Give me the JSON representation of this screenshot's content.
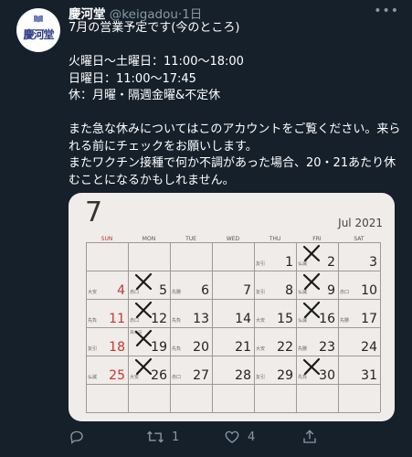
{
  "account": {
    "avatar_text": "慶河堂",
    "name": "慶河堂",
    "handle": "@keigadou",
    "separator": "·",
    "time": "1日",
    "more_icon": "more-dots-icon"
  },
  "tweet": {
    "lines": [
      "7月の営業予定です(今のところ)",
      "",
      "火曜日～土曜日：11:00～18:00",
      "日曜日：11:00～17:45",
      "休：月曜・隔週金曜&不定休",
      "",
      "また急な休みについてはこのアカウントをご覧ください。来られる前にチェックをお願いします。",
      "またワクチン接種で何か不調があった場合、20・21あたり休むことになるかもしれません。"
    ]
  },
  "calendar": {
    "month": "7",
    "year_label": "Jul 2021",
    "weekdays": [
      "SUN",
      "MON",
      "TUE",
      "WED",
      "THU",
      "FRI",
      "SAT"
    ],
    "weeks": [
      [
        {
          "num": "",
          "note": "",
          "x": false
        },
        {
          "num": "",
          "note": "",
          "x": false
        },
        {
          "num": "",
          "note": "",
          "x": false
        },
        {
          "num": "",
          "note": "",
          "x": false
        },
        {
          "num": "1",
          "note": "友引",
          "x": false
        },
        {
          "num": "2",
          "note": "仏滅",
          "x": true
        },
        {
          "num": "3",
          "note": "",
          "x": false
        }
      ],
      [
        {
          "num": "4",
          "note": "大安",
          "x": false
        },
        {
          "num": "5",
          "note": "赤口",
          "x": true
        },
        {
          "num": "6",
          "note": "先勝",
          "x": false
        },
        {
          "num": "7",
          "note": "",
          "x": false
        },
        {
          "num": "8",
          "note": "友引",
          "x": false
        },
        {
          "num": "9",
          "note": "仏滅",
          "x": true
        },
        {
          "num": "10",
          "note": "赤口",
          "x": false
        }
      ],
      [
        {
          "num": "11",
          "note": "先負",
          "x": false
        },
        {
          "num": "12",
          "note": "赤口",
          "x": true
        },
        {
          "num": "13",
          "note": "先負",
          "x": false
        },
        {
          "num": "14",
          "note": "",
          "x": false
        },
        {
          "num": "15",
          "note": "大安",
          "x": false
        },
        {
          "num": "16",
          "note": "仏滅",
          "x": true
        },
        {
          "num": "17",
          "note": "先勝",
          "x": false
        }
      ],
      [
        {
          "num": "18",
          "note": "友引",
          "x": false
        },
        {
          "num": "19",
          "note": "",
          "x": true,
          "sub": "海の日"
        },
        {
          "num": "20",
          "note": "先負",
          "x": false
        },
        {
          "num": "21",
          "note": "",
          "x": false
        },
        {
          "num": "22",
          "note": "大安",
          "x": false
        },
        {
          "num": "23",
          "note": "先勝",
          "x": false
        },
        {
          "num": "24",
          "note": "",
          "x": false
        }
      ],
      [
        {
          "num": "25",
          "note": "仏滅",
          "x": false
        },
        {
          "num": "26",
          "note": "大安",
          "x": true
        },
        {
          "num": "27",
          "note": "赤口",
          "x": false
        },
        {
          "num": "28",
          "note": "",
          "x": false
        },
        {
          "num": "29",
          "note": "友引",
          "x": false
        },
        {
          "num": "30",
          "note": "先負",
          "x": true
        },
        {
          "num": "31",
          "note": "",
          "x": false
        }
      ]
    ]
  },
  "actions": {
    "reply_icon": "reply-icon",
    "retweet_icon": "retweet-icon",
    "retweet_count": "1",
    "like_icon": "heart-icon",
    "like_count": "4",
    "share_icon": "share-icon"
  },
  "colors": {
    "background": "#15202b",
    "muted": "#8899a6",
    "sunday": "#c0392b"
  }
}
